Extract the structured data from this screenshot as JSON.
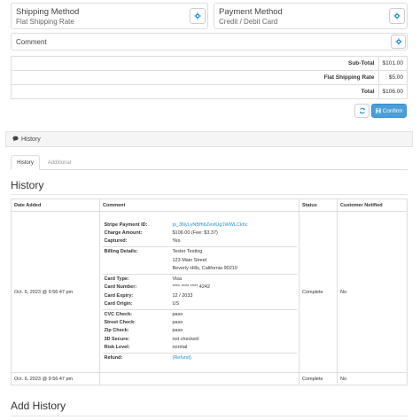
{
  "shipping": {
    "title": "Shipping Method",
    "value": "Flat Shipping Rate",
    "icon": "gear-icon"
  },
  "payment": {
    "title": "Payment Method",
    "value": "Credit / Debit Card",
    "icon": "gear-icon"
  },
  "comment": {
    "title": "Comment",
    "icon": "gear-icon"
  },
  "totals": [
    {
      "label": "Sub-Total",
      "value": "$101.00"
    },
    {
      "label": "Flat Shipping Rate",
      "value": "$5.00"
    },
    {
      "label": "Total",
      "value": "$106.00"
    }
  ],
  "actions": {
    "refresh_icon": "refresh-icon",
    "confirm_label": "Confirm",
    "confirm_icon": "save-icon"
  },
  "colors": {
    "primary": "#1e91cf",
    "accent": "#4a9fd8"
  },
  "history_panel": {
    "title": "History",
    "icon": "comment-icon",
    "tabs": [
      "History",
      "Additional"
    ],
    "active_tab": "History",
    "heading": "History",
    "columns": [
      "Date Added",
      "Comment",
      "Status",
      "Customer Notified"
    ],
    "rows": [
      {
        "date": "Oct. 6, 2023 @ 9:56:47 pm",
        "status": "Complete",
        "notified": "No",
        "details": {
          "stripe_payment_id_label": "Stripe Payment ID:",
          "stripe_payment_id_value": "pi_3NyLvNBfh6ZevtUg1WWLCkhc",
          "charge_amount_label": "Charge Amount:",
          "charge_amount_value": "$106.00 (Fee: $3.37)",
          "captured_label": "Captured:",
          "captured_value": "Yes",
          "billing_label": "Billing Details:",
          "billing_lines": [
            "Tester Testing",
            "123 Main Street",
            "Beverly Hills, California 90210"
          ],
          "card_type_label": "Card Type:",
          "card_type_value": "Visa",
          "card_number_label": "Card Number:",
          "card_number_value": "**** **** **** 4242",
          "card_expiry_label": "Card Expiry:",
          "card_expiry_value": "12 / 2033",
          "card_origin_label": "Card Origin:",
          "card_origin_value": "US",
          "cvc_label": "CVC Check:",
          "cvc_value": "pass",
          "street_label": "Street Check:",
          "street_value": "pass",
          "zip_label": "Zip Check:",
          "zip_value": "pass",
          "secure_label": "3D Secure:",
          "secure_value": "not checked",
          "risk_label": "Risk Level:",
          "risk_value": "normal",
          "refund_label": "Refund:",
          "refund_value": "(Refund)"
        }
      },
      {
        "date": "Oct. 6, 2023 @ 9:56:47 pm",
        "comment": "",
        "status": "Complete",
        "notified": "No"
      }
    ]
  },
  "add_history": {
    "heading": "Add History"
  }
}
